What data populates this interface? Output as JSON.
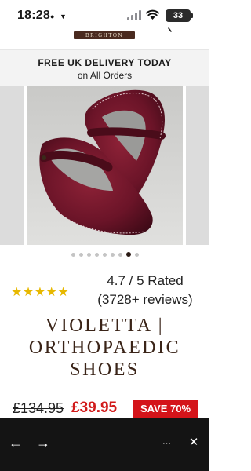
{
  "status_bar": {
    "time": "18:28",
    "battery": "33"
  },
  "header": {
    "brand": "BRIGHTON"
  },
  "promo": {
    "title": "FREE UK DELIVERY TODAY",
    "subtitle": "on All Orders"
  },
  "gallery": {
    "dot_count": 9,
    "active_index": 7
  },
  "rating": {
    "stars": "★★★★★",
    "score": "4.7 / 5 Rated",
    "reviews": "(3728+ reviews)"
  },
  "product": {
    "title_line1": "VIOLETTA |",
    "title_line2": "ORTHOPAEDIC",
    "title_line3": "SHOES",
    "price_old": "£134.95",
    "price_new": "£39.95",
    "save_label": "SAVE 70%"
  },
  "browser_bar": {
    "back_icon": "←",
    "forward_icon": "→",
    "more_icon": "···",
    "close_icon": "✕"
  },
  "colors": {
    "brand": "#3a2418",
    "sale_red": "#d4141a",
    "star": "#e7b800",
    "shoe": "#6b1428"
  }
}
